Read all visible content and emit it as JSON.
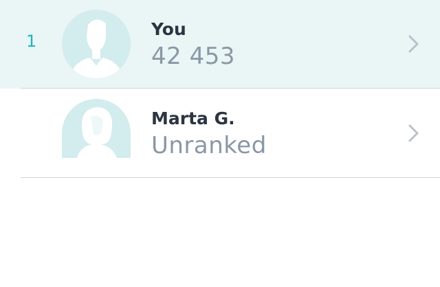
{
  "leaderboard": {
    "rows": [
      {
        "rank": "1",
        "name": "You",
        "score": "42 453",
        "avatar_icon": "male-avatar-icon",
        "highlighted": true
      },
      {
        "rank": "",
        "name": "Marta G.",
        "score": "Unranked",
        "avatar_icon": "female-avatar-icon",
        "highlighted": false
      }
    ]
  },
  "colors": {
    "highlight_bg": "#eaf5f6",
    "rank_accent": "#1fb3b8",
    "avatar_bg": "#d3ecee",
    "name_text": "#2b3440",
    "score_text": "#8a97a5",
    "chevron": "#b9c2c9"
  }
}
